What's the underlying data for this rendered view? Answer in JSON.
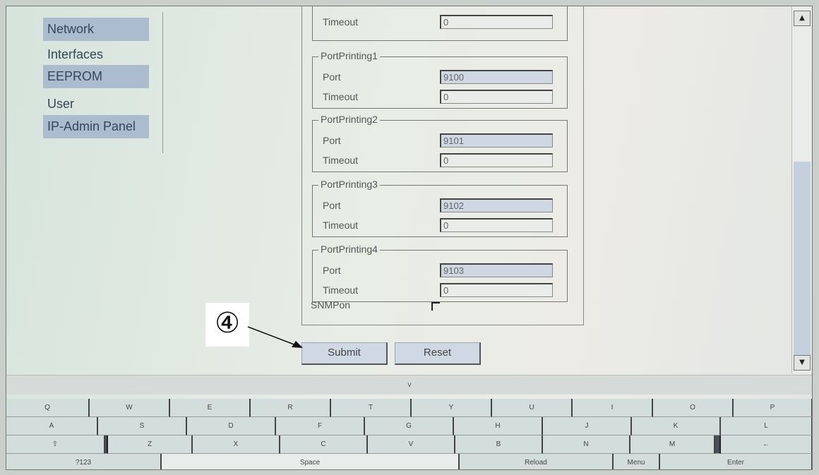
{
  "sidebar": {
    "items": [
      {
        "label": "Network"
      },
      {
        "label": "Interfaces"
      },
      {
        "label": "EEPROM"
      },
      {
        "label": "User"
      },
      {
        "label": "IP-Admin Panel"
      }
    ]
  },
  "form": {
    "top_timeout": {
      "label": "Timeout",
      "value": "0"
    },
    "groups": [
      {
        "legend": "PortPrinting1",
        "port_label": "Port",
        "port_value": "9100",
        "timeout_label": "Timeout",
        "timeout_value": "0"
      },
      {
        "legend": "PortPrinting2",
        "port_label": "Port",
        "port_value": "9101",
        "timeout_label": "Timeout",
        "timeout_value": "0"
      },
      {
        "legend": "PortPrinting3",
        "port_label": "Port",
        "port_value": "9102",
        "timeout_label": "Timeout",
        "timeout_value": "0"
      },
      {
        "legend": "PortPrinting4",
        "port_label": "Port",
        "port_value": "9103",
        "timeout_label": "Timeout",
        "timeout_value": "0"
      }
    ],
    "snmp": {
      "label": "SNMPon",
      "checked": false
    },
    "submit_label": "Submit",
    "reset_label": "Reset"
  },
  "annotation": {
    "label": "④"
  },
  "keyboard": {
    "toggle": "v",
    "row1": [
      "Q",
      "W",
      "E",
      "R",
      "T",
      "Y",
      "U",
      "I",
      "O",
      "P"
    ],
    "row2": [
      "A",
      "S",
      "D",
      "F",
      "G",
      "H",
      "J",
      "K",
      "L"
    ],
    "row3": [
      "⇧",
      "Z",
      "X",
      "C",
      "V",
      "B",
      "N",
      "M",
      "←"
    ],
    "row4": [
      "?123",
      "Space",
      "Reload",
      "Menu",
      "Enter"
    ]
  }
}
